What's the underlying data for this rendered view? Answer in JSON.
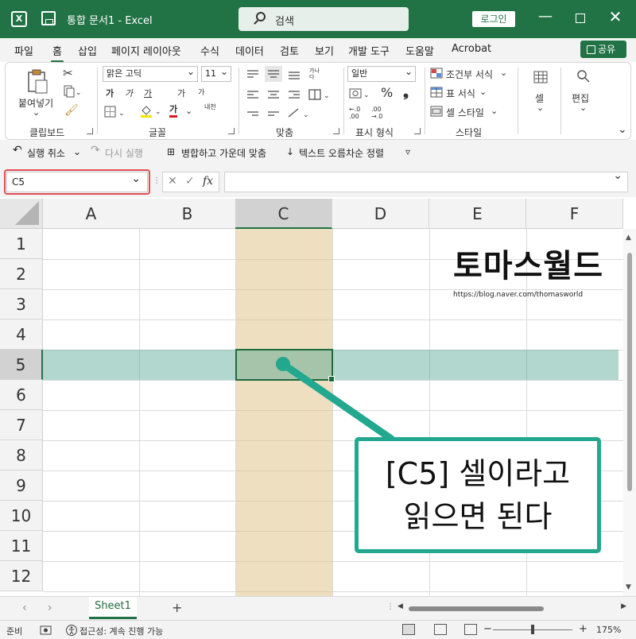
{
  "titlebar": {
    "app_glyph": "X",
    "title": "통합 문서1  -  Excel",
    "search_label": "검색",
    "login_label": "로그인",
    "minimize": "—",
    "close": "✕"
  },
  "tabs": [
    "파일",
    "홈",
    "삽입",
    "페이지 레이아웃",
    "수식",
    "데이터",
    "검토",
    "보기",
    "개발 도구",
    "도움말",
    "Acrobat"
  ],
  "share_label": "공유",
  "ribbon": {
    "clipboard": {
      "paste": "붙여넣기",
      "label": "클립보드"
    },
    "font": {
      "name": "맑은 고딕",
      "size": "11",
      "label": "글꼴",
      "bold": "가",
      "italic": "가",
      "underline": "가",
      "grow": "가",
      "shrink": "가",
      "color_glyph": "가",
      "phonetic": "내천"
    },
    "align": {
      "label": "맞춤",
      "wrap": "가나다"
    },
    "number": {
      "format": "일반",
      "percent": "%",
      "comma": "❟",
      "inc": "←.0 .00",
      "dec": ".00 →.0",
      "label": "표시 형식"
    },
    "styles": {
      "conditional": "조건부 서식",
      "table": "표 서식",
      "cell": "셀 스타일",
      "label": "스타일"
    },
    "cells": {
      "label": "셀"
    },
    "editing": {
      "label": "편집"
    }
  },
  "qat": {
    "undo": "실행 취소",
    "redo": "다시 실행",
    "merge": "병합하고 가운데 맞춤",
    "sort": "텍스트 오름차순 정렬",
    "more": "▿"
  },
  "formula": {
    "name_box": "C5",
    "cancel": "✕",
    "enter": "✓",
    "fx": "fx"
  },
  "grid": {
    "columns": [
      "A",
      "B",
      "C",
      "D",
      "E",
      "F"
    ],
    "rows": [
      "1",
      "2",
      "3",
      "4",
      "5",
      "6",
      "7",
      "8",
      "9",
      "10",
      "11",
      "12"
    ],
    "selected_column": "C",
    "selected_row": "5"
  },
  "watermark": {
    "title": "토마스월드",
    "url": "https://blog.naver.com/thomasworld"
  },
  "callout": {
    "line1": "[C5] 셀이라고",
    "line2": "읽으면 된다",
    "color": "#22a88f"
  },
  "sheets": {
    "prev": "‹",
    "next": "›",
    "active": "Sheet1",
    "add": "+"
  },
  "status": {
    "ready": "준비",
    "accessibility": "접근성: 계속 진행 가능",
    "zoom_minus": "−",
    "zoom_plus": "+",
    "zoom": "175%"
  },
  "colors": {
    "accent": "#217346"
  }
}
